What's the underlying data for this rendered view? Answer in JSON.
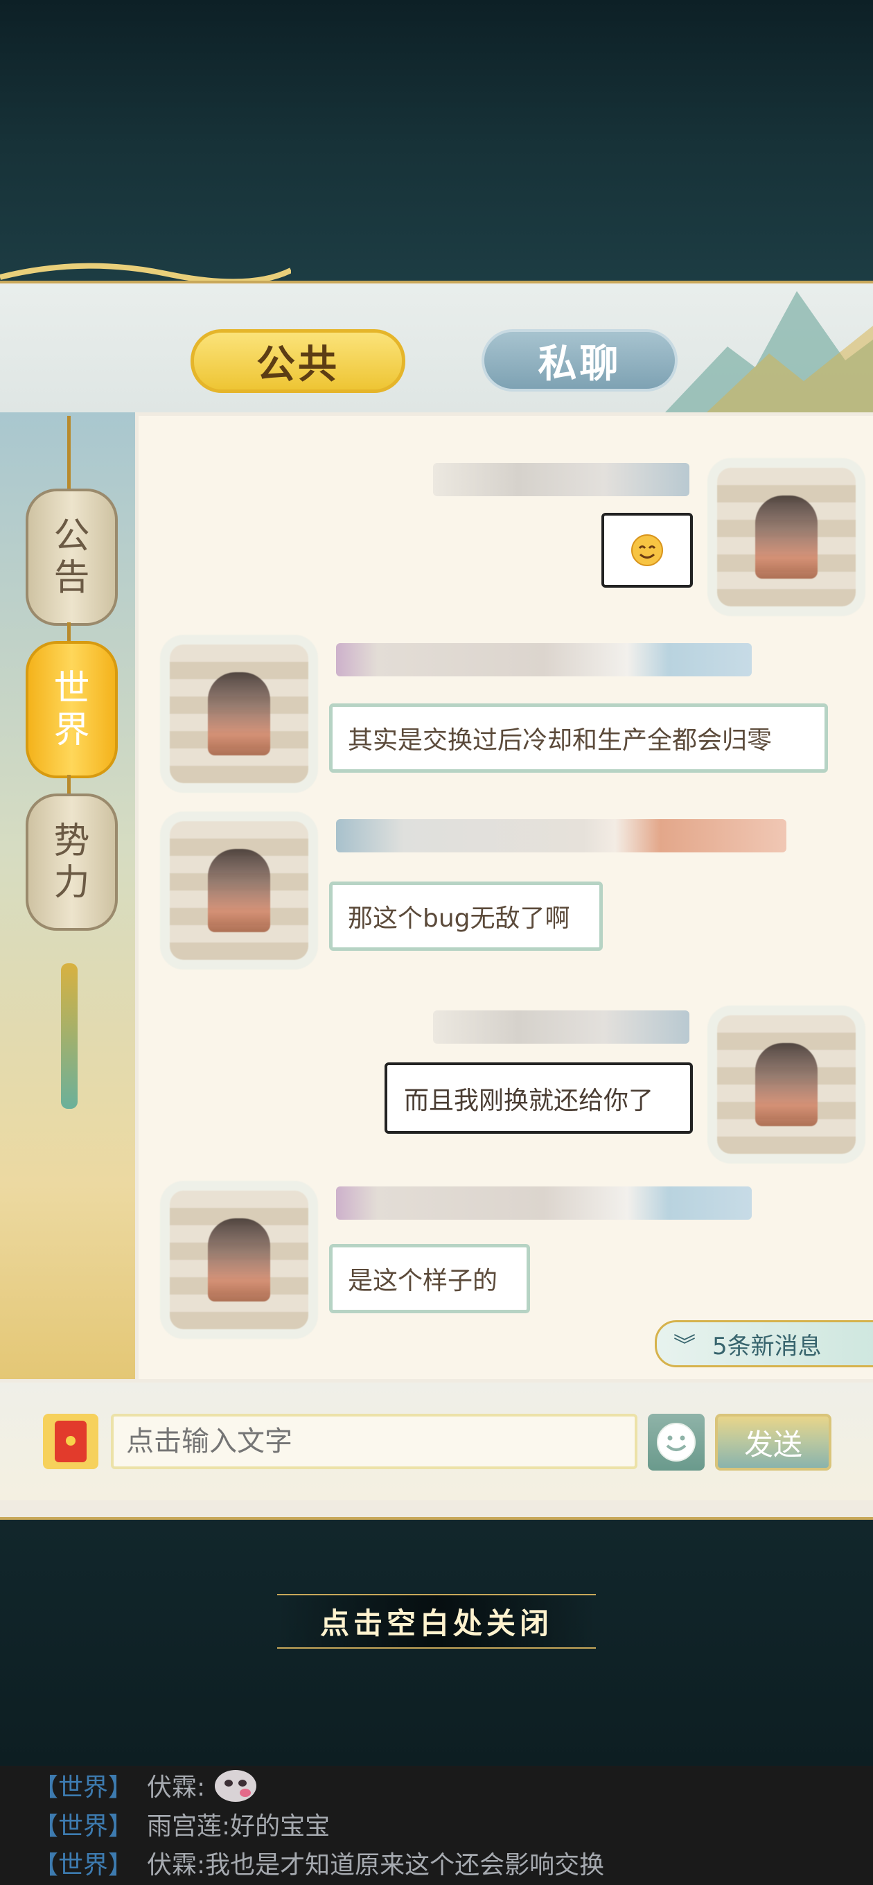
{
  "tabs": {
    "public_label": "公共",
    "private_label": "私聊"
  },
  "channels": [
    {
      "label_top": "公",
      "label_bottom": "告"
    },
    {
      "label_top": "世",
      "label_bottom": "界"
    },
    {
      "label_top": "势",
      "label_bottom": "力"
    }
  ],
  "messages": [
    {
      "side": "right",
      "text": ""
    },
    {
      "side": "left",
      "text": "其实是交换过后冷却和生产全都会归零"
    },
    {
      "side": "left",
      "text": "那这个bug无敌了啊"
    },
    {
      "side": "right",
      "text": "而且我刚换就还给你了"
    },
    {
      "side": "left",
      "text": "是这个样子的"
    }
  ],
  "new_messages_label": "5条新消息",
  "input": {
    "placeholder": "点击输入文字",
    "send_label": "发送"
  },
  "close_hint": "点击空白处关闭",
  "ticker": [
    {
      "channel": "【世界】",
      "name": "伏霖:",
      "text": ""
    },
    {
      "channel": "【世界】",
      "name": "雨宫莲:",
      "text": "好的宝宝"
    },
    {
      "channel": "【世界】",
      "name": "伏霖:",
      "text": "我也是才知道原来这个还会影响交换"
    }
  ],
  "colors": {
    "accent_gold": "#eec534",
    "panel_bg": "#faf5ea",
    "bubble_border": "#b6d3c4"
  }
}
